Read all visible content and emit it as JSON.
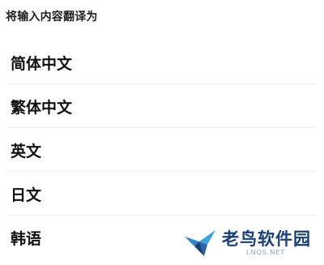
{
  "header": {
    "title": "将输入内容翻译为"
  },
  "languages": [
    {
      "label": "简体中文"
    },
    {
      "label": "繁体中文"
    },
    {
      "label": "英文"
    },
    {
      "label": "日文"
    },
    {
      "label": "韩语"
    }
  ],
  "watermark": {
    "text": "老鸟软件园",
    "subtext": "LNQS.NET",
    "icon": "bird-logo-icon",
    "color": "#1a3e78"
  }
}
